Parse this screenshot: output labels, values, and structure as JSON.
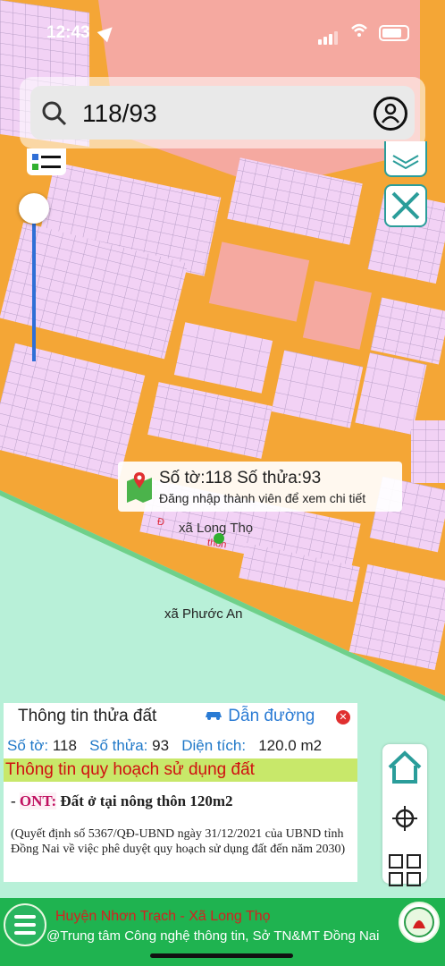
{
  "status_bar": {
    "time": "12:43"
  },
  "search": {
    "query": "118/93"
  },
  "popup": {
    "parcel_line": "Số tờ:118 Số thửa:93",
    "login_hint": "Đăng nhập thành viên để xem chi tiết"
  },
  "map_labels": {
    "commune_long_tho": "xã Long Thọ",
    "commune_phuoc_an": "xã Phước An",
    "road_fragment": "Đ",
    "hamlet_fragment": "thôn"
  },
  "panel": {
    "title": "Thông tin thửa đất",
    "directions_label": "Dẫn đường",
    "so_to_label": "Số tờ:",
    "so_to_value": "118",
    "so_thua_label": "Số thửa:",
    "so_thua_value": "93",
    "dien_tich_label": "Diện tích:",
    "dien_tich_value": "120.0 m2",
    "planning_header": "Thông tin quy hoạch sử dụng đất",
    "zone_code": "ONT:",
    "zone_desc": "Đất ở tại nông thôn 120m2",
    "decision_text": "(Quyết định số 5367/QĐ-UBND ngày 31/12/2021 của UBND tỉnh Đồng Nai về việc phê duyệt quy hoạch sử dụng đất đến năm 2030)"
  },
  "footer": {
    "district_line": "Huyện Nhơn Trạch - Xã Long Thọ",
    "credit_line": "@Trung tâm Công nghệ thông tin, Sở TN&MT Đồng Nai"
  },
  "colors": {
    "road": "#f4a636",
    "parcel": "#f2d2f5",
    "parcel_public": "#f5a9a0",
    "river_bank": "#b8f0d8",
    "footer": "#1fb350",
    "planning_bar": "#c8e86a"
  }
}
